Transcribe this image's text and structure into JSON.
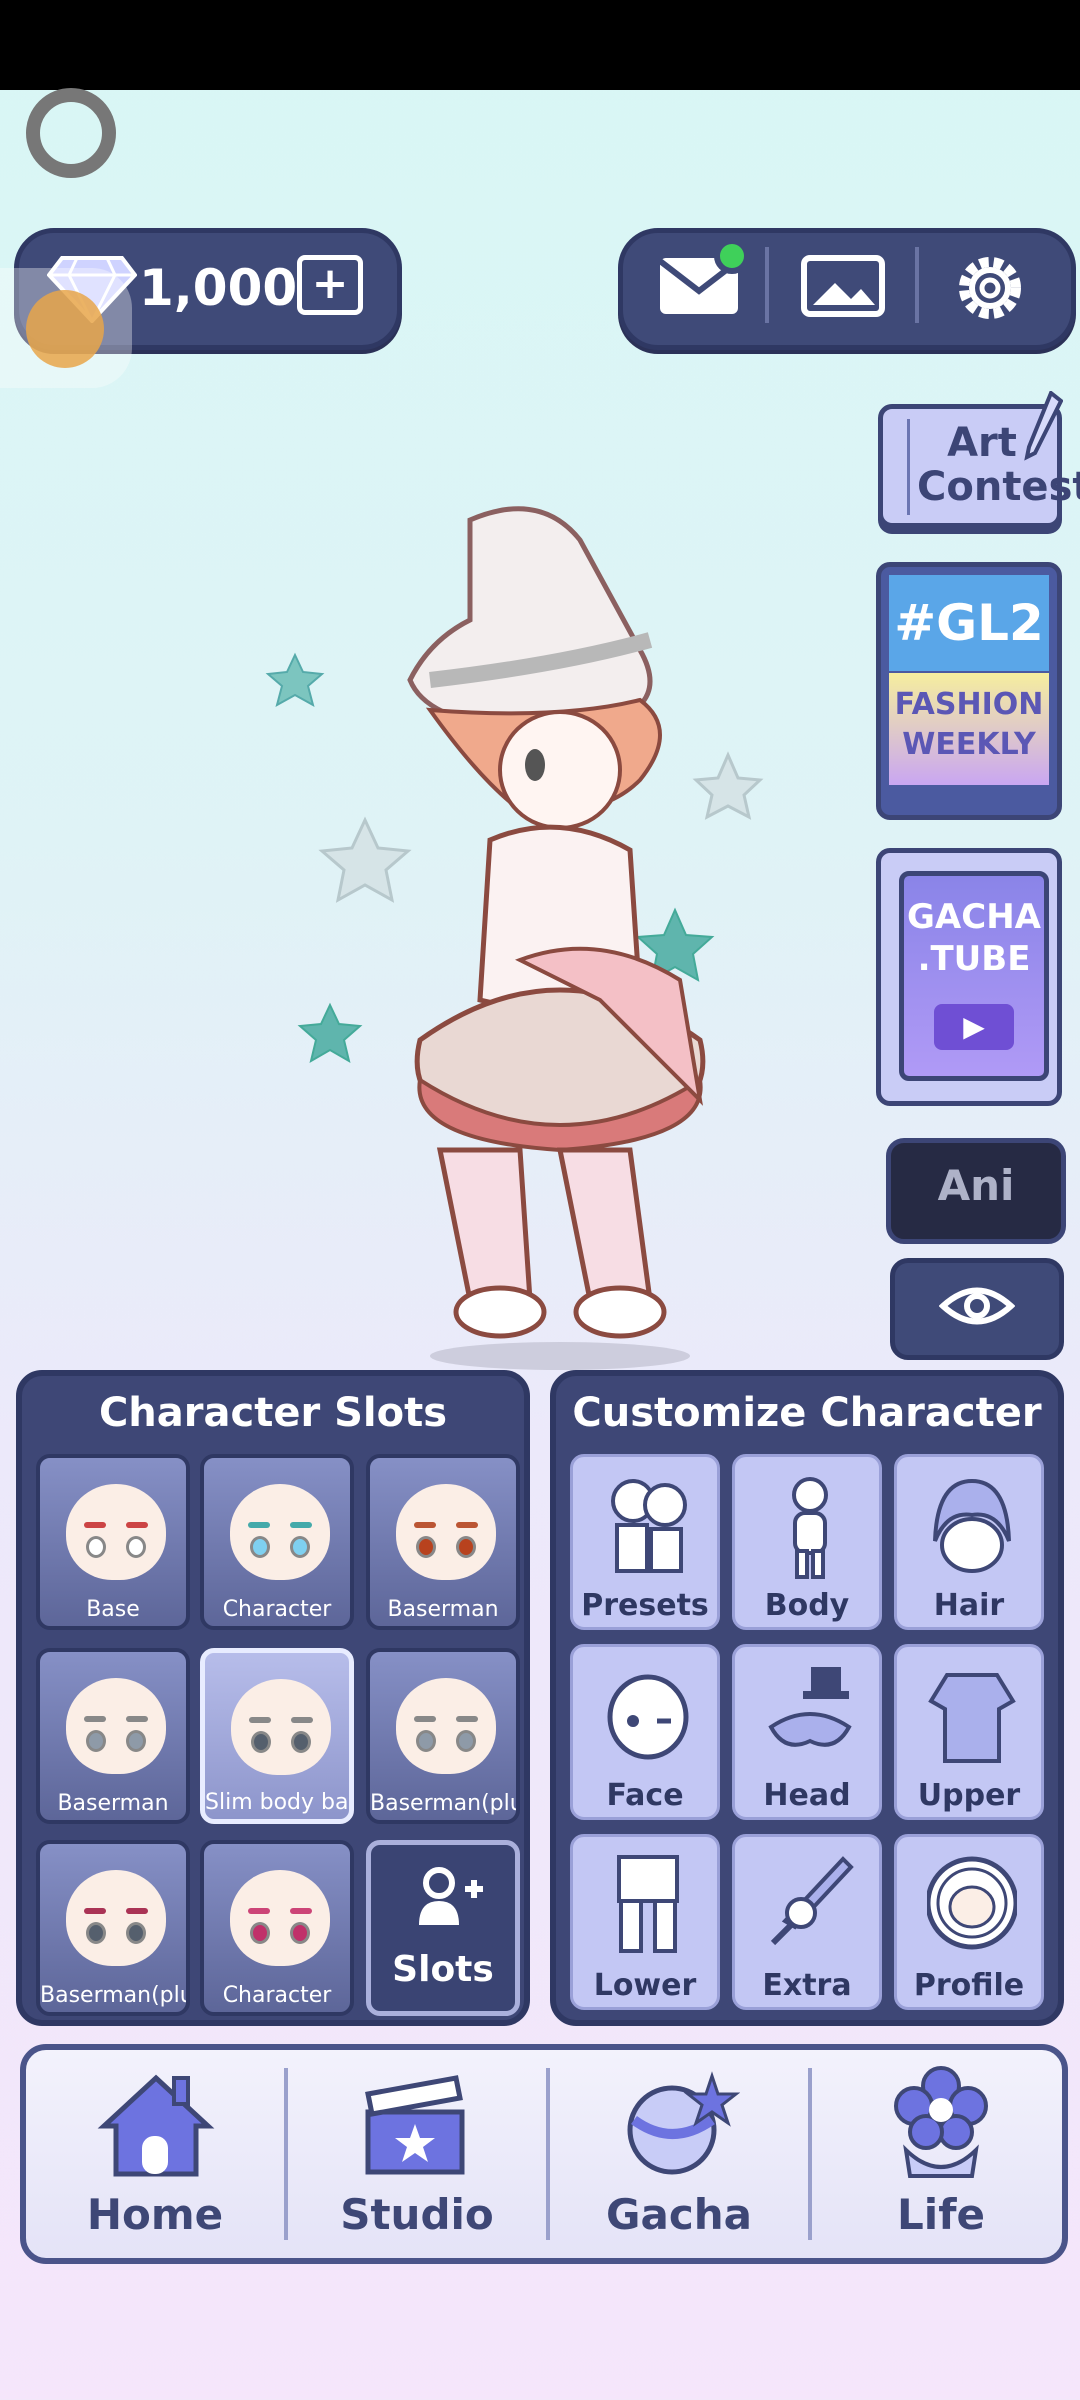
{
  "currency": {
    "gems": "1,000"
  },
  "side_buttons": {
    "art_contest": "Art Contest",
    "gl2_tag": "#GL2",
    "fashion_weekly": "FASHION WEEKLY",
    "gacha_tube": "GACHA .TUBE",
    "ani": "Ani"
  },
  "slots_panel": {
    "title": "Character Slots",
    "slots": [
      {
        "label": "Base",
        "eye": "#ffffff",
        "brow": "#c44"
      },
      {
        "label": "Character",
        "eye": "#7fd0f0",
        "brow": "#4aa"
      },
      {
        "label": "Baserman",
        "eye": "#b8421e",
        "brow": "#b53"
      },
      {
        "label": "Baserman",
        "eye": "#8e9aa8",
        "brow": "#888"
      },
      {
        "label": "Slim body bas",
        "eye": "#555f6d",
        "brow": "#888"
      },
      {
        "label": "Baserman(plu",
        "eye": "#8e9aa8",
        "brow": "#888"
      },
      {
        "label": "Baserman(plu",
        "eye": "#555f6d",
        "brow": "#a35"
      },
      {
        "label": "Character",
        "eye": "#c0306a",
        "brow": "#c47"
      }
    ],
    "add_label": "Slots"
  },
  "custom_panel": {
    "title": "Customize Character",
    "items": [
      "Presets",
      "Body",
      "Hair",
      "Face",
      "Head",
      "Upper",
      "Lower",
      "Extra",
      "Profile"
    ]
  },
  "nav": {
    "items": [
      "Home",
      "Studio",
      "Gacha",
      "Life"
    ]
  }
}
